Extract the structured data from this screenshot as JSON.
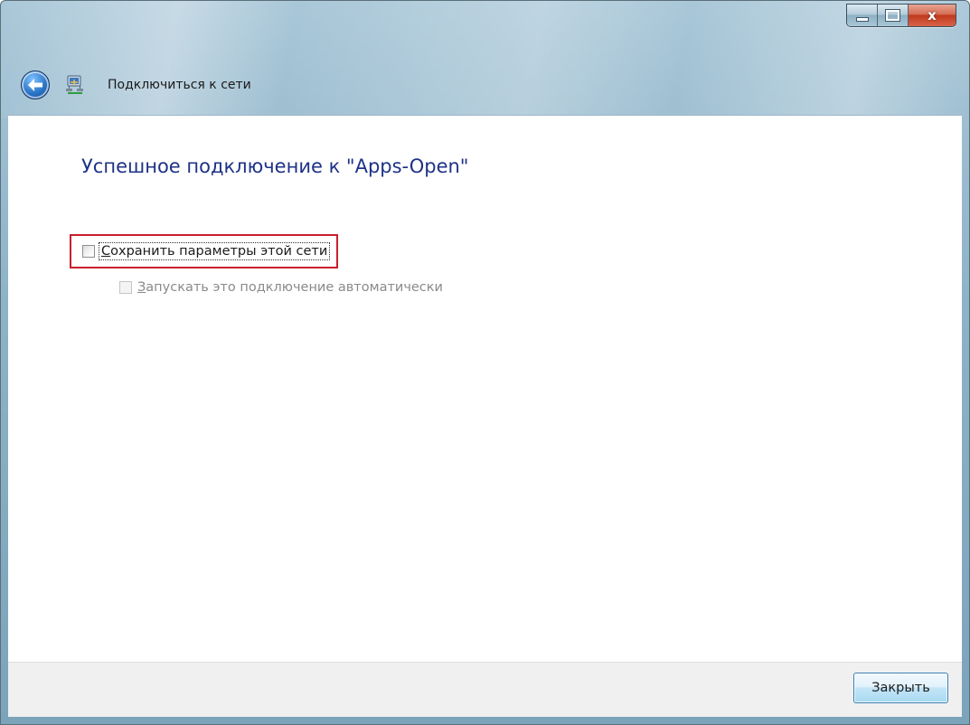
{
  "window": {
    "caption_buttons": {
      "minimize_icon": "minimize-icon",
      "maximize_icon": "maximize-icon",
      "close_glyph": "x"
    }
  },
  "nav": {
    "back_icon": "back-arrow-icon",
    "app_icon": "network-connect-icon",
    "title": "Подключиться к сети"
  },
  "main": {
    "heading": "Успешное подключение к \"Apps-Open\"",
    "save_checkbox": {
      "label_first": "С",
      "label_rest": "охранить параметры этой сети",
      "checked": false,
      "highlighted": true
    },
    "auto_checkbox": {
      "label_first": "З",
      "label_rest": "апускать это подключение автоматически",
      "checked": false,
      "disabled": true
    }
  },
  "footer": {
    "close_button": "Закрыть"
  },
  "colors": {
    "heading": "#1e3287",
    "highlight_border": "#c8202c",
    "disabled_text": "#8a8a8a"
  }
}
